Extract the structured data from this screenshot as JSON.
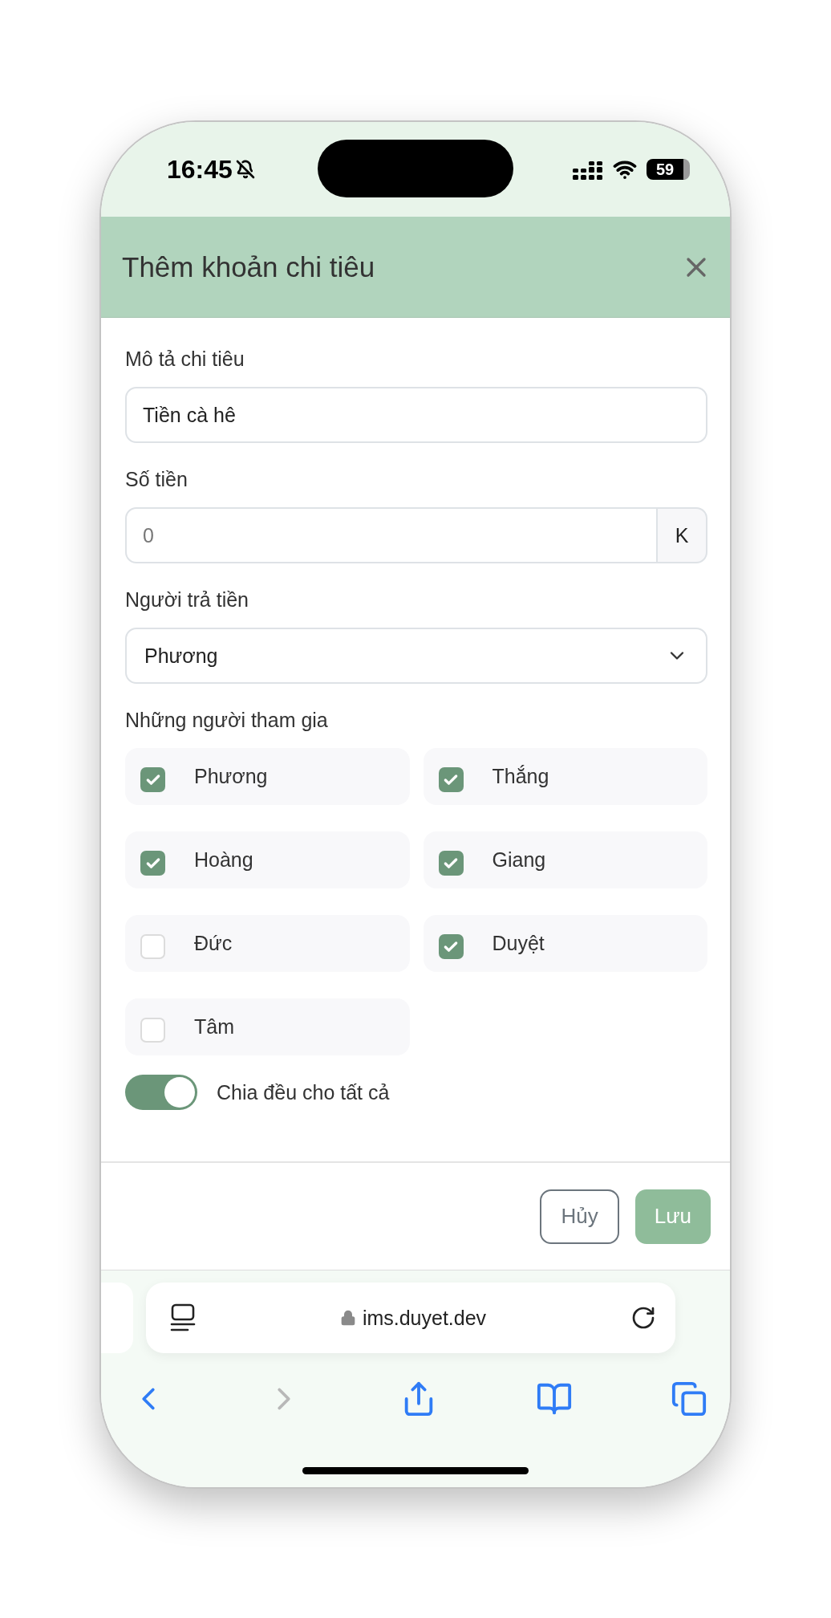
{
  "status_bar": {
    "time": "16:45",
    "battery": "59"
  },
  "dialog": {
    "title": "Thêm khoản chi tiêu",
    "description": {
      "label": "Mô tả chi tiêu",
      "value": "Tiền cà hê"
    },
    "amount": {
      "label": "Số tiền",
      "placeholder": "0",
      "suffix": "K"
    },
    "payer": {
      "label": "Người trả tiền",
      "value": "Phương"
    },
    "participants": {
      "label": "Những người tham gia",
      "items": [
        {
          "name": "Phương",
          "checked": true
        },
        {
          "name": "Thắng",
          "checked": true
        },
        {
          "name": "Hoàng",
          "checked": true
        },
        {
          "name": "Giang",
          "checked": true
        },
        {
          "name": "Đức",
          "checked": false
        },
        {
          "name": "Duyệt",
          "checked": true
        },
        {
          "name": "Tâm",
          "checked": false
        }
      ]
    },
    "split_equally": {
      "label": "Chia đều cho tất cả",
      "on": true
    },
    "buttons": [
      {
        "label": "Hủy",
        "kind": "secondary"
      },
      {
        "label": "Lưu",
        "kind": "primary"
      }
    ]
  },
  "browser": {
    "url": "ims.duyet.dev"
  }
}
